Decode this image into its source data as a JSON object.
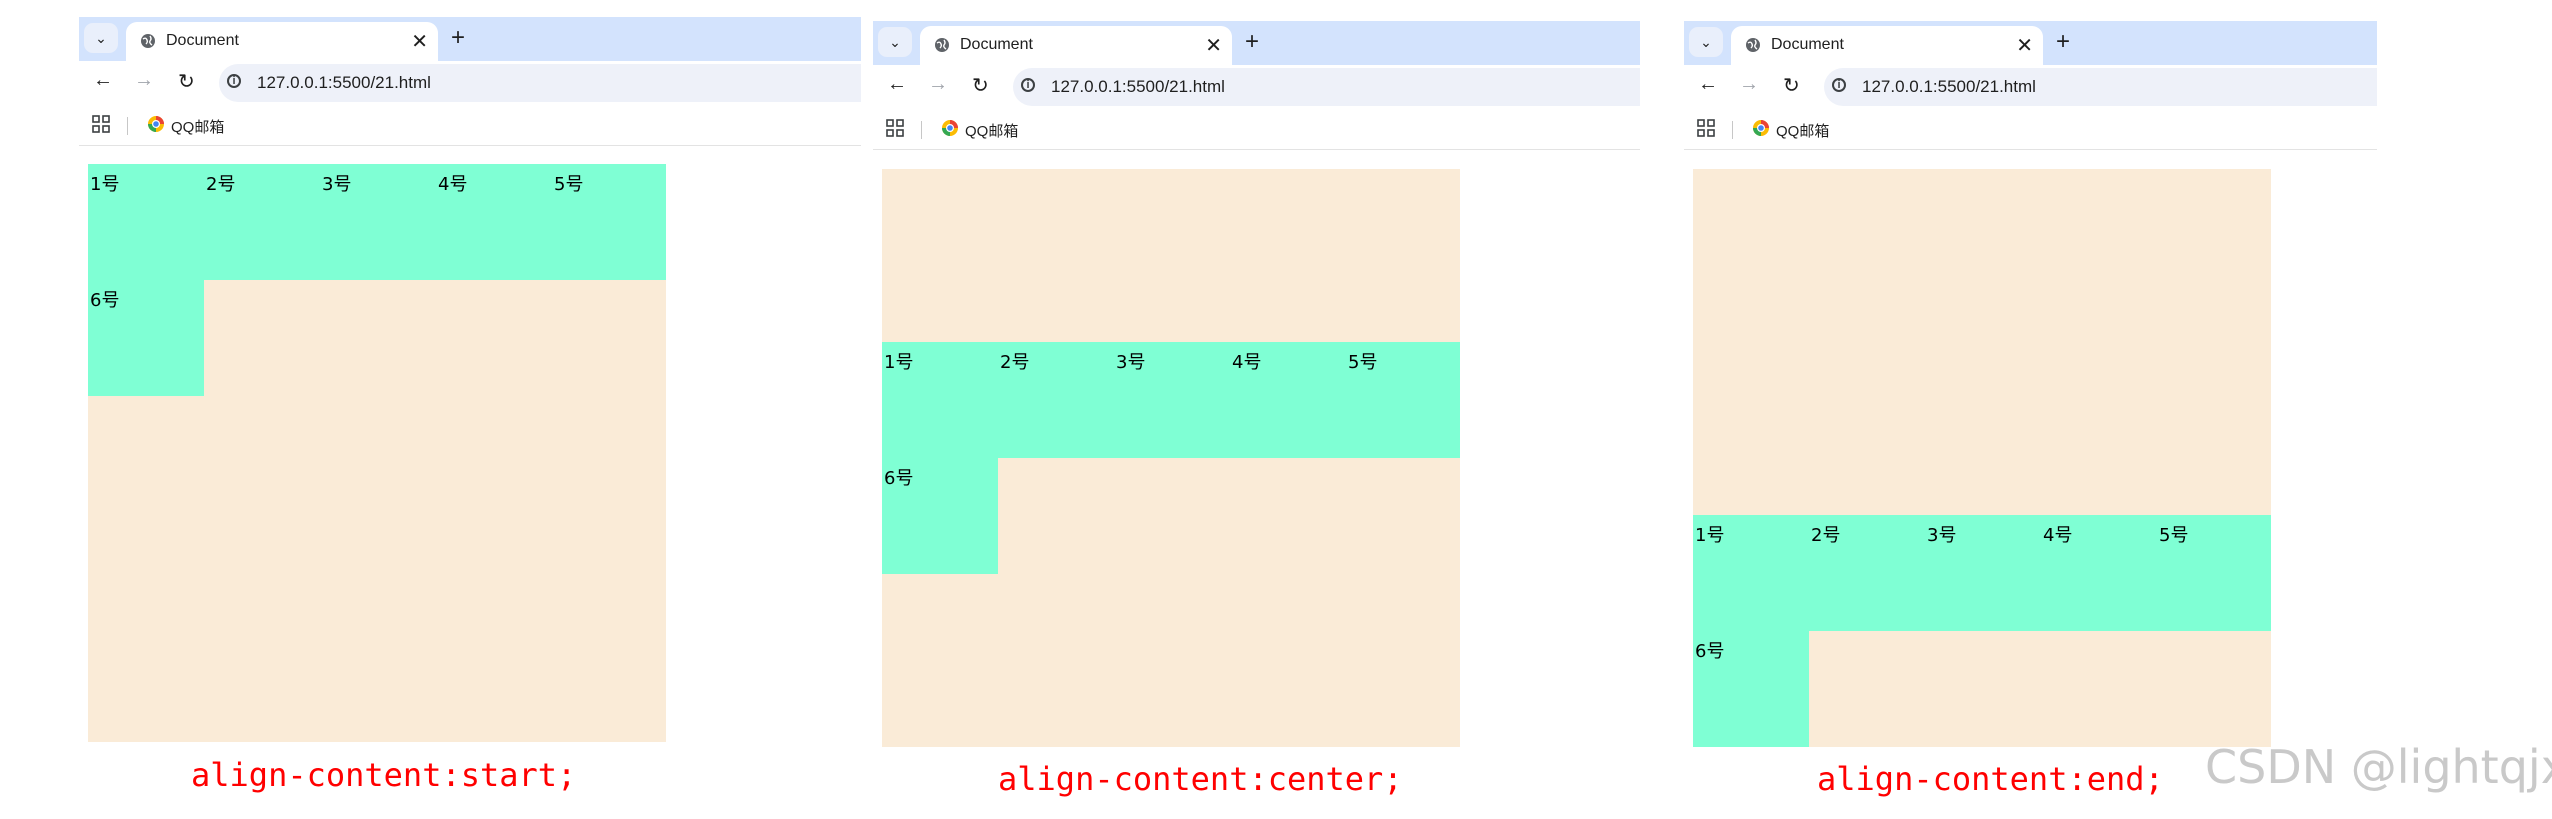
{
  "screenshots": [
    {
      "tab_title": "Document",
      "new_tab": "+",
      "url": "127.0.0.1:5500/21.html",
      "bookmark": "QQ邮箱",
      "items": [
        "1号",
        "2号",
        "3号",
        "4号",
        "5号",
        "6号"
      ],
      "caption": "align-content:start;"
    },
    {
      "tab_title": "Document",
      "new_tab": "+",
      "url": "127.0.0.1:5500/21.html",
      "bookmark": "QQ邮箱",
      "items": [
        "1号",
        "2号",
        "3号",
        "4号",
        "5号",
        "6号"
      ],
      "caption": "align-content:center;"
    },
    {
      "tab_title": "Document",
      "new_tab": "+",
      "url": "127.0.0.1:5500/21.html",
      "bookmark": "QQ邮箱",
      "items": [
        "1号",
        "2号",
        "3号",
        "4号",
        "5号",
        "6号"
      ],
      "caption": "align-content:end;"
    }
  ],
  "watermark": "CSDN @lightqjx",
  "colors": {
    "container_bg": "#faebd7",
    "item_bg": "#7fffd4",
    "caption": "#ff0000",
    "tab_strip": "#d3e3fd"
  },
  "icons": {
    "tab_list": "chevron-down-icon",
    "favicon": "globe-icon",
    "back": "arrow-left-icon",
    "forward": "arrow-right-icon",
    "reload": "reload-icon",
    "site_info": "info-icon",
    "apps": "apps-grid-icon",
    "bookmark_favicon": "qq-mail-icon",
    "close_tab": "close-icon"
  }
}
